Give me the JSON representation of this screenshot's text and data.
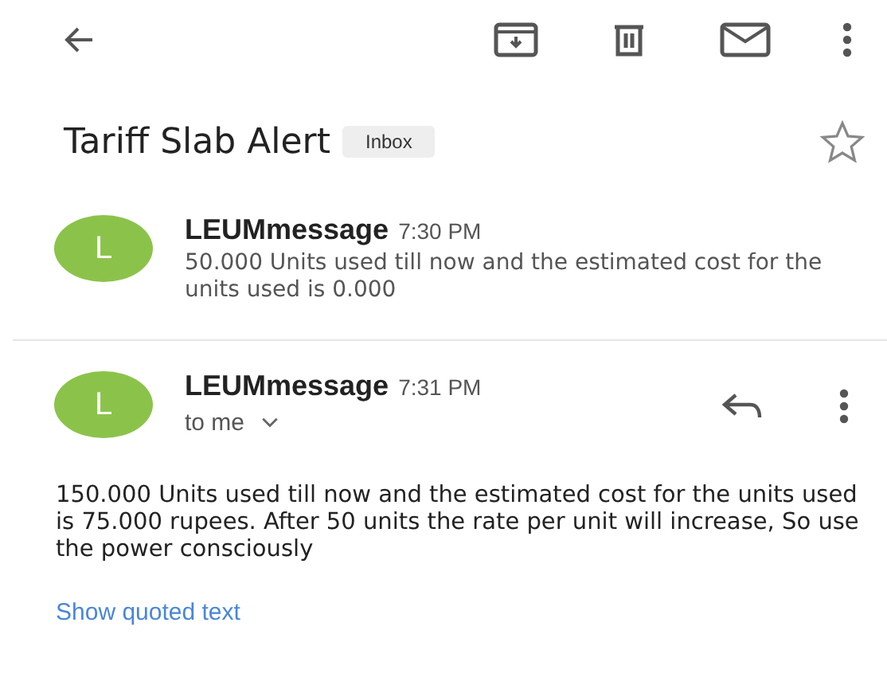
{
  "subject": {
    "title": "Tariff Slab Alert",
    "label": "Inbox",
    "starred": false
  },
  "messages": [
    {
      "kind": "collapsed",
      "avatar": "L",
      "color": "#8bc34a",
      "sender": "LEUMmessage",
      "time": "7:30 PM",
      "preview": "50.000 Units used till now and the estimated cost for the units used is 0.000"
    },
    {
      "kind": "expanded",
      "avatar": "L",
      "color": "#8bc34a",
      "sender": "LEUMmessage",
      "time": "7:31 PM",
      "recipient": "to me",
      "body": "150.000 Units used till now and the estimated cost for the units used is 75.000 rupees. After 50 units the rate per unit will increase, So use the power consciously",
      "link": "Show quoted text"
    }
  ]
}
